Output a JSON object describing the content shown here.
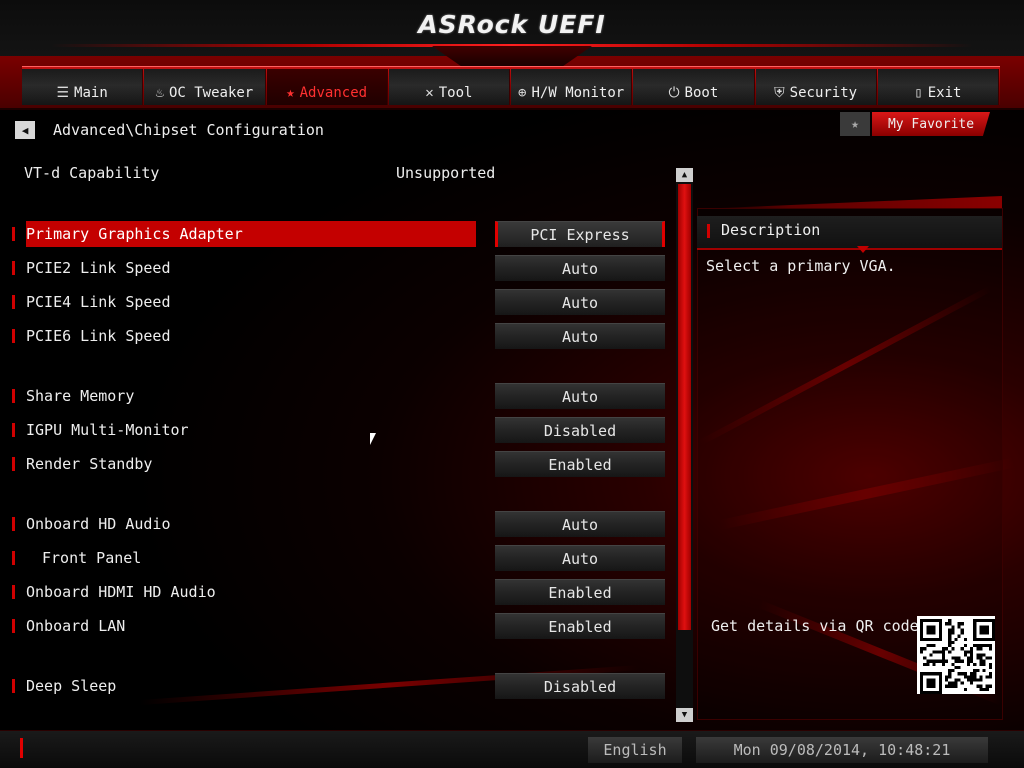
{
  "header": {
    "logo": "ASRock UEFI"
  },
  "nav": {
    "tabs": [
      {
        "label": "Main",
        "icon": "list-icon",
        "glyph": "☰",
        "active": false
      },
      {
        "label": "OC Tweaker",
        "icon": "flame-icon",
        "glyph": "♨",
        "active": false
      },
      {
        "label": "Advanced",
        "icon": "star-icon",
        "glyph": "★",
        "active": true
      },
      {
        "label": "Tool",
        "icon": "wrench-icon",
        "glyph": "✕",
        "active": false
      },
      {
        "label": "H/W Monitor",
        "icon": "globe-icon",
        "glyph": "⊕",
        "active": false
      },
      {
        "label": "Boot",
        "icon": "power-icon",
        "glyph": "⏻",
        "active": false
      },
      {
        "label": "Security",
        "icon": "shield-icon",
        "glyph": "⛨",
        "active": false
      },
      {
        "label": "Exit",
        "icon": "door-icon",
        "glyph": "▯",
        "active": false
      }
    ]
  },
  "breadcrumb": {
    "back_glyph": "◀",
    "path": "Advanced\\Chipset Configuration"
  },
  "favorite": {
    "star_glyph": "★",
    "label": "My Favorite"
  },
  "info": {
    "label": "VT-d Capability",
    "value": "Unsupported"
  },
  "settings": [
    {
      "label": "Primary Graphics Adapter",
      "value": "PCI Express",
      "selected": true,
      "indent": false
    },
    {
      "label": "PCIE2 Link Speed",
      "value": "Auto",
      "selected": false,
      "indent": false
    },
    {
      "label": "PCIE4 Link Speed",
      "value": "Auto",
      "selected": false,
      "indent": false
    },
    {
      "label": "PCIE6 Link Speed",
      "value": "Auto",
      "selected": false,
      "indent": false
    },
    {
      "label": "Share Memory",
      "value": "Auto",
      "selected": false,
      "indent": false
    },
    {
      "label": "IGPU Multi-Monitor",
      "value": "Disabled",
      "selected": false,
      "indent": false
    },
    {
      "label": "Render Standby",
      "value": "Enabled",
      "selected": false,
      "indent": false
    },
    {
      "label": "Onboard HD Audio",
      "value": "Auto",
      "selected": false,
      "indent": false
    },
    {
      "label": "Front Panel",
      "value": "Auto",
      "selected": false,
      "indent": true
    },
    {
      "label": "Onboard HDMI HD Audio",
      "value": "Enabled",
      "selected": false,
      "indent": false
    },
    {
      "label": "Onboard LAN",
      "value": "Enabled",
      "selected": false,
      "indent": false
    },
    {
      "label": "Deep Sleep",
      "value": "Disabled",
      "selected": false,
      "indent": false
    }
  ],
  "scrollbar": {
    "up_glyph": "▲",
    "down_glyph": "▼"
  },
  "description": {
    "title": "Description",
    "text": "Select a primary VGA.",
    "qr_caption": "Get details via QR code"
  },
  "footer": {
    "language": "English",
    "datetime": "Mon 09/08/2014, 10:48:21"
  },
  "colors": {
    "accent": "#c40000",
    "accent_bright": "#ff2020",
    "background": "#000000",
    "text": "#e8e8e8"
  }
}
